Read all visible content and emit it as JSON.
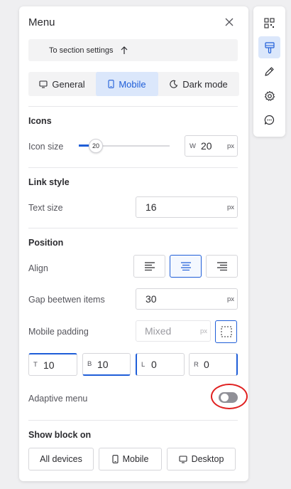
{
  "menu": {
    "title": "Menu"
  },
  "to_section": {
    "label": "To section settings"
  },
  "tabs": [
    {
      "label": "General",
      "icon": "monitor-icon"
    },
    {
      "label": "Mobile",
      "icon": "phone-icon",
      "active": true
    },
    {
      "label": "Dark mode",
      "icon": "moon-icon"
    }
  ],
  "icons_section": {
    "title": "Icons",
    "size_label": "Icon size",
    "slider_value": "20",
    "width_prefix": "W",
    "width_value": "20",
    "width_unit": "px"
  },
  "link_style": {
    "title": "Link style",
    "text_size_label": "Text size",
    "text_size_value": "16",
    "text_size_unit": "px"
  },
  "position": {
    "title": "Position",
    "align_label": "Align",
    "align_options": [
      "left",
      "center",
      "right"
    ],
    "align_selected": "center",
    "gap_label": "Gap beetwen items",
    "gap_value": "30",
    "gap_unit": "px",
    "mobile_padding_label": "Mobile padding",
    "mobile_padding_placeholder": "Mixed",
    "mobile_padding_unit": "px",
    "padding": {
      "top_prefix": "T",
      "top_value": "10",
      "bottom_prefix": "B",
      "bottom_value": "10",
      "left_prefix": "L",
      "left_value": "0",
      "right_prefix": "R",
      "right_value": "0"
    },
    "adaptive_label": "Adaptive menu",
    "adaptive_enabled": false
  },
  "show_block": {
    "title": "Show block on",
    "all_devices": "All devices",
    "mobile": "Mobile",
    "desktop": "Desktop"
  },
  "toolbar": [
    "qr-code-icon",
    "paint-brush-icon",
    "pencil-icon",
    "gear-icon",
    "chat-icon"
  ],
  "colors": {
    "accent": "#1f5ed8",
    "accent_bg": "#dbe7fb",
    "highlight": "#e02020"
  }
}
